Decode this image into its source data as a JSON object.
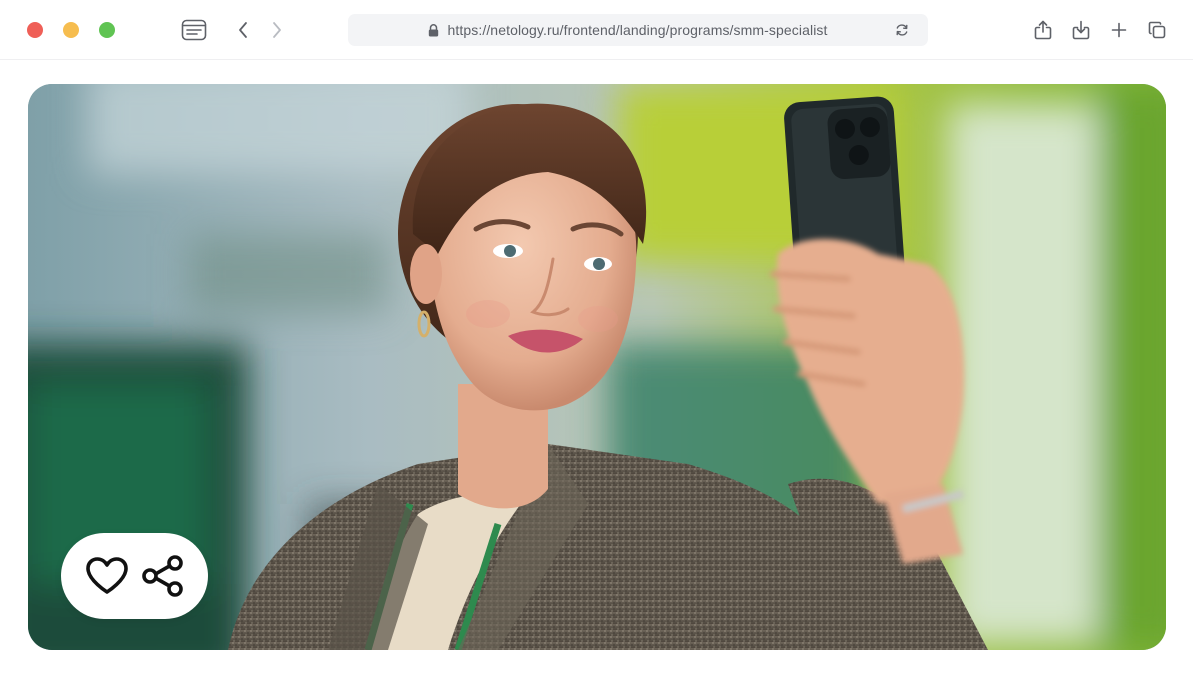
{
  "window": {
    "traffic_lights": {
      "close_color": "#ef5f57",
      "minimize_color": "#f6bd4f",
      "zoom_color": "#60c453"
    }
  },
  "toolbar": {
    "reader_icon": "reader-view-icon",
    "back_icon": "chevron-left-icon",
    "forward_icon": "chevron-right-icon",
    "share_icon": "share-icon",
    "download_icon": "download-icon",
    "new_tab_icon": "plus-icon",
    "tabs_icon": "tabs-overview-icon"
  },
  "address_bar": {
    "lock_icon": "lock-icon",
    "url": "https://netology.ru/frontend/landing/programs/smm-specialist",
    "reload_icon": "reload-icon"
  },
  "hero": {
    "image_subject": "woman-taking-selfie-photo",
    "actions": {
      "favorite_icon": "heart-icon",
      "share_icon": "share-nodes-icon"
    }
  },
  "colors": {
    "address_bar_bg": "#f3f4f6",
    "icon_gray": "#5e6168",
    "action_icon": "#111111"
  }
}
